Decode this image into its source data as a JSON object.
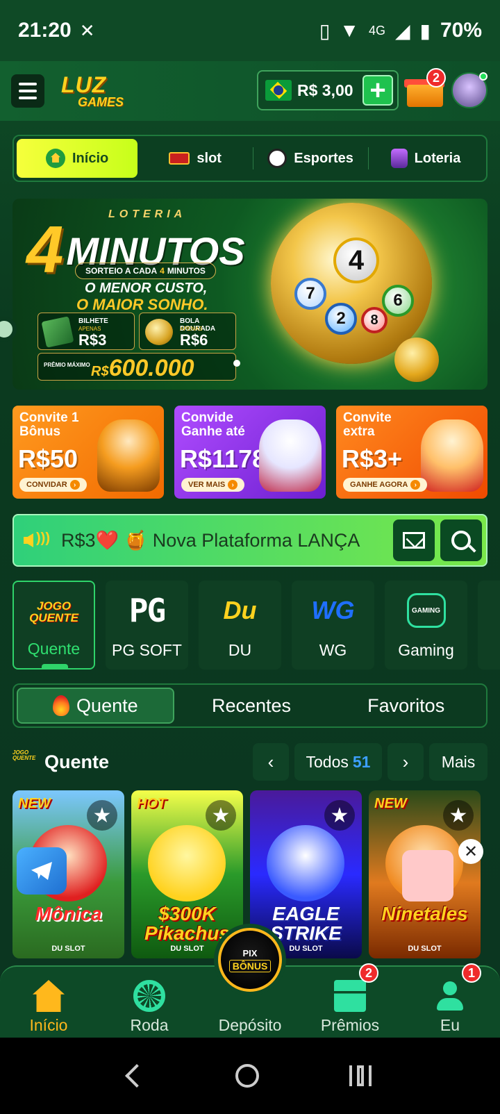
{
  "status_bar": {
    "time": "21:20",
    "network": "4G",
    "battery": "70%"
  },
  "header": {
    "logo_line1": "LUZ",
    "logo_line2": "GAMES",
    "balance": "R$ 3,00",
    "add_symbol": "+",
    "gift_badge": "2"
  },
  "main_tabs": [
    {
      "label": "Início",
      "icon": "home-icon"
    },
    {
      "label": "slot",
      "icon": "slot-icon"
    },
    {
      "label": "Esportes",
      "icon": "soccer-ball-icon"
    },
    {
      "label": "Loteria",
      "icon": "lottery-icon"
    }
  ],
  "hero": {
    "brand": "LOTERIA",
    "big_number": "4",
    "big_word": "MINUTOS",
    "sorteio_pre": "SORTEIO A CADA",
    "sorteio_num": "4",
    "sorteio_post": "MINUTOS",
    "slogan1": "O MENOR CUSTO,",
    "slogan2": "O MAIOR SONHO.",
    "card1_label": "BILHETE",
    "card1_sub": "APENAS",
    "card1_value": "R$3",
    "card2_label": "BOLA DOURADA",
    "card2_sub": "APENAS",
    "card2_value": "R$6",
    "premio_label": "PRÊMIO MÁXIMO",
    "premio_currency": "R$",
    "premio_value": "600.000",
    "balls": [
      "4",
      "7",
      "2",
      "8",
      "6"
    ]
  },
  "promos": [
    {
      "line1": "Convite 1",
      "line2": "Bônus",
      "amount": "R$50",
      "button": "CONVIDAR"
    },
    {
      "line1": "Convide",
      "line2": "Ganhe até",
      "amount": "R$1178",
      "button": "VER MAIS"
    },
    {
      "line1": "Convite",
      "line2": "extra",
      "amount": "R$3+",
      "button": "GANHE AGORA"
    }
  ],
  "marquee": {
    "text": "R$3❤️ 🍯 Nova Plataforma LANÇA"
  },
  "providers": [
    {
      "label": "Quente",
      "logo_text": "JOGO QUENTE"
    },
    {
      "label": "PG SOFT",
      "logo_text": "PG"
    },
    {
      "label": "DU",
      "logo_text": "Du"
    },
    {
      "label": "WG",
      "logo_text": "WG"
    },
    {
      "label": "Gaming",
      "logo_text": "GAMING"
    }
  ],
  "filters": [
    {
      "label": "Quente"
    },
    {
      "label": "Recentes"
    },
    {
      "label": "Favoritos"
    }
  ],
  "section": {
    "title": "Quente",
    "logo_text": "JOGO QUENTE",
    "all_label": "Todos",
    "all_count": "51",
    "more_label": "Mais",
    "prev": "‹",
    "next": "›"
  },
  "games": [
    {
      "tag": "NEW",
      "title": "Mônica",
      "provider": "DU SLOT"
    },
    {
      "tag": "HOT",
      "title": "$300K Pikachus",
      "provider": "DU SLOT"
    },
    {
      "tag": "",
      "title": "EAGLE STRIKE",
      "provider": "DU SLOT"
    },
    {
      "tag": "NEW",
      "title": "Ninetales",
      "provider": "DU SLOT"
    }
  ],
  "bottom_nav": [
    {
      "label": "Início",
      "icon": "home-icon"
    },
    {
      "label": "Roda",
      "icon": "wheel-icon"
    },
    {
      "label": "Depósito",
      "icon": "pix-bonus-icon"
    },
    {
      "label": "Prêmios",
      "icon": "gift-icon",
      "badge": "2"
    },
    {
      "label": "Eu",
      "icon": "user-icon",
      "badge": "1"
    }
  ],
  "deposit_button": {
    "line1": "PIX",
    "line2": "BÔNUS"
  },
  "colors": {
    "accent_yellow": "#f6ff3c",
    "brand_green": "#0f4d27",
    "nav_active": "#ffb81c",
    "badge_red": "#ef2b2b"
  }
}
